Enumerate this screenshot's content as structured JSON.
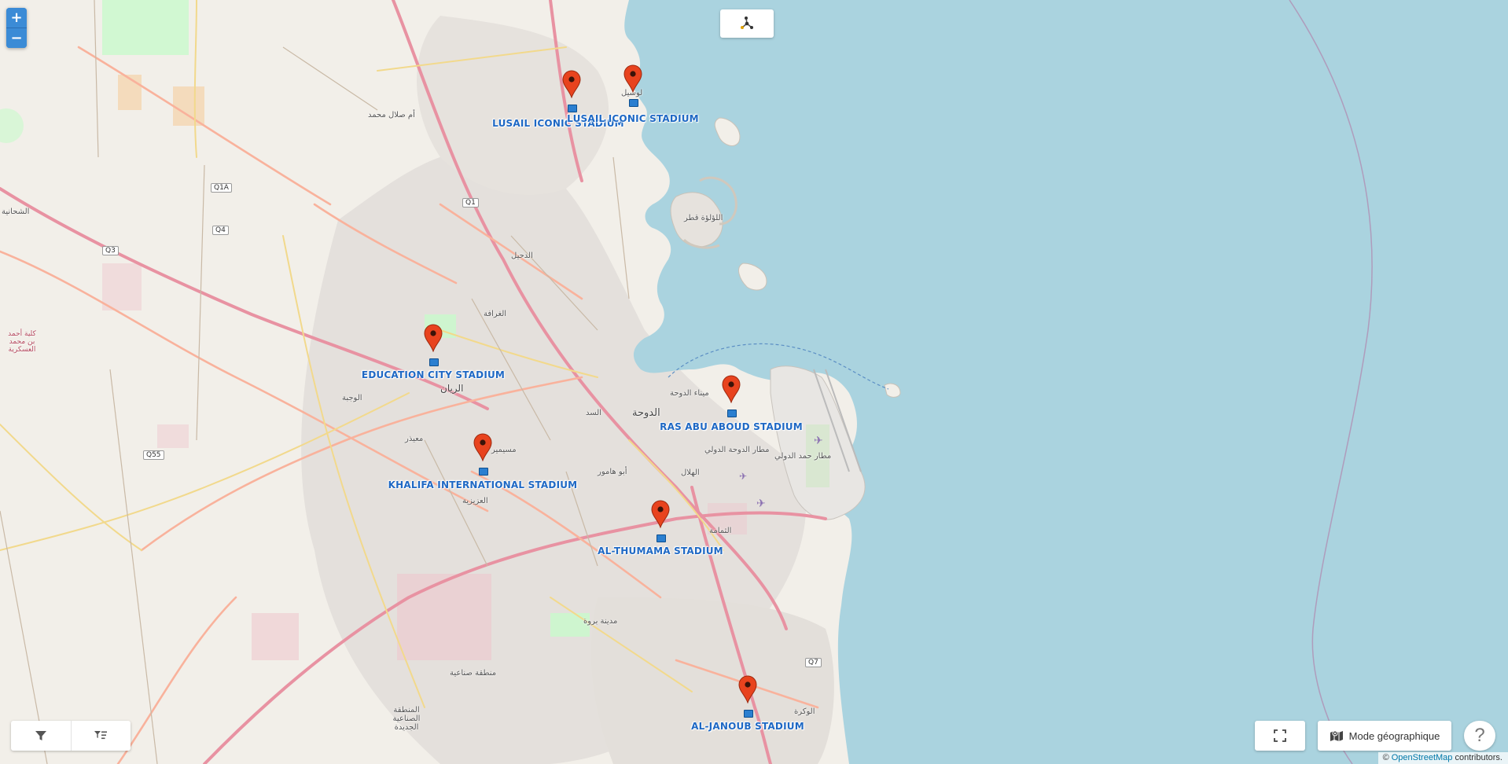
{
  "controls": {
    "zoom_in": "+",
    "zoom_out": "−",
    "geo_mode_label": "Mode géographique",
    "help_label": "?",
    "top_icon": "network-graph-icon",
    "filter_icon": "filter-icon",
    "list_filter_icon": "sort-filter-icon",
    "fullscreen_icon": "fullscreen-icon",
    "geo_mode_icon": "map-icon"
  },
  "attribution": {
    "prefix": "© ",
    "link": "OpenStreetMap",
    "suffix": " contributors."
  },
  "stadiums": [
    {
      "name": "LUSAIL ICONIC STADIUM",
      "label_offset": "left"
    },
    {
      "name": "LUSAIL ICONIC STADIUM",
      "label_offset": "right"
    },
    {
      "name": "EDUCATION CITY STADIUM"
    },
    {
      "name": "RAS ABU ABOUD STADIUM"
    },
    {
      "name": "KHALIFA INTERNATIONAL STADIUM"
    },
    {
      "name": "AL-THUMAMA STADIUM"
    },
    {
      "name": "AL-JANOUB STADIUM"
    }
  ],
  "places": {
    "lusail": "لوسيل",
    "umm_salal": "أم صلال محمد",
    "shahaniya": "الشحانية",
    "military_college": "كلية أحمد بن محمد العسكرية",
    "wajba": "الوجبة",
    "muaither": "معيذر",
    "rayyan": "الريان",
    "doha": "الدوحة",
    "doha_port": "ميناء الدوحة",
    "airport": "مطار الدوحة الدولي",
    "hamad_airport": "مطار حمد الدولي",
    "wakra": "الوكرة",
    "pearl": "اللؤلؤة قطر",
    "barwa": "مدينة بروة",
    "industrial": "منطقة صناعية",
    "mesaimeer": "مسيمير",
    "thumama": "الثمامة",
    "aziziya": "العزيزية",
    "gharrafa": "الغرافة",
    "hilal": "الهلال",
    "sadd": "السد",
    "duhail": "الدحيل",
    "abu_hamour": "أبو هامور",
    "new_industrial": "المنطقة الصناعية الجديدة"
  },
  "road_shields": [
    "Q1A",
    "Q4",
    "Q3",
    "Q1",
    "Q55",
    "Q7"
  ],
  "colors": {
    "water": "#aad3df",
    "land": "#f2efe9",
    "urban": "#e0dfdf",
    "park": "#c8facc",
    "motorway": "#e892a2",
    "trunk": "#f9b29c",
    "primary": "#fcd6a4",
    "secondary": "#f7fabf",
    "marker": "#e8431e",
    "label": "#1e68c4"
  }
}
